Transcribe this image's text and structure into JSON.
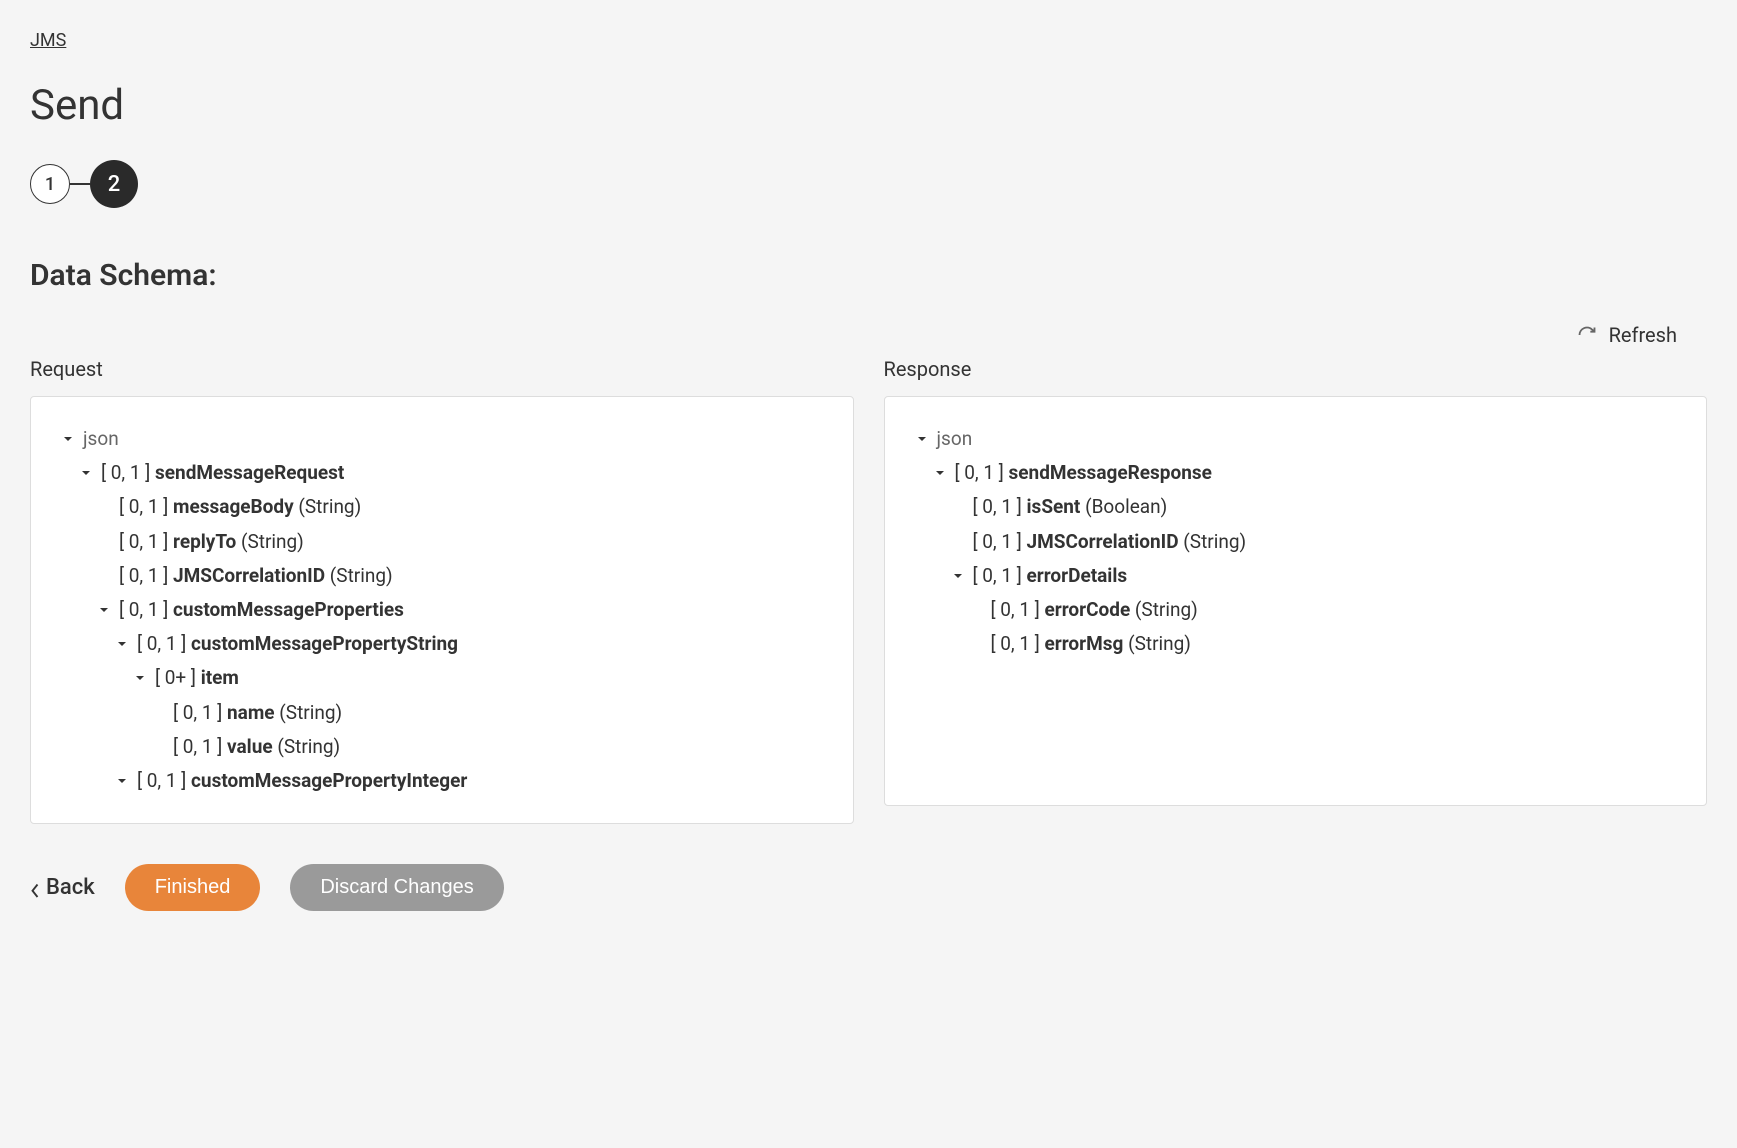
{
  "breadcrumb": "JMS",
  "page_title": "Send",
  "steps": {
    "s1": "1",
    "s2": "2"
  },
  "section_title": "Data Schema:",
  "refresh_label": "Refresh",
  "request": {
    "label": "Request",
    "tree": [
      {
        "indent": 0,
        "expandable": true,
        "root": "json"
      },
      {
        "indent": 1,
        "expandable": true,
        "cardinality": "[ 0, 1 ]",
        "name": "sendMessageRequest"
      },
      {
        "indent": 2,
        "expandable": false,
        "cardinality": "[ 0, 1 ]",
        "name": "messageBody",
        "type": "(String)"
      },
      {
        "indent": 2,
        "expandable": false,
        "cardinality": "[ 0, 1 ]",
        "name": "replyTo",
        "type": "(String)"
      },
      {
        "indent": 2,
        "expandable": false,
        "cardinality": "[ 0, 1 ]",
        "name": "JMSCorrelationID",
        "type": "(String)"
      },
      {
        "indent": 2,
        "expandable": true,
        "cardinality": "[ 0, 1 ]",
        "name": "customMessageProperties"
      },
      {
        "indent": 3,
        "expandable": true,
        "cardinality": "[ 0, 1 ]",
        "name": "customMessagePropertyString"
      },
      {
        "indent": 4,
        "expandable": true,
        "cardinality": "[ 0+ ]",
        "name": "item"
      },
      {
        "indent": 5,
        "expandable": false,
        "cardinality": "[ 0, 1 ]",
        "name": "name",
        "type": "(String)"
      },
      {
        "indent": 5,
        "expandable": false,
        "cardinality": "[ 0, 1 ]",
        "name": "value",
        "type": "(String)"
      },
      {
        "indent": 3,
        "expandable": true,
        "cardinality": "[ 0, 1 ]",
        "name": "customMessagePropertyInteger"
      }
    ]
  },
  "response": {
    "label": "Response",
    "tree": [
      {
        "indent": 0,
        "expandable": true,
        "root": "json"
      },
      {
        "indent": 1,
        "expandable": true,
        "cardinality": "[ 0, 1 ]",
        "name": "sendMessageResponse"
      },
      {
        "indent": 2,
        "expandable": false,
        "cardinality": "[ 0, 1 ]",
        "name": "isSent",
        "type": "(Boolean)"
      },
      {
        "indent": 2,
        "expandable": false,
        "cardinality": "[ 0, 1 ]",
        "name": "JMSCorrelationID",
        "type": "(String)"
      },
      {
        "indent": 2,
        "expandable": true,
        "cardinality": "[ 0, 1 ]",
        "name": "errorDetails"
      },
      {
        "indent": 3,
        "expandable": false,
        "cardinality": "[ 0, 1 ]",
        "name": "errorCode",
        "type": "(String)"
      },
      {
        "indent": 3,
        "expandable": false,
        "cardinality": "[ 0, 1 ]",
        "name": "errorMsg",
        "type": "(String)"
      }
    ]
  },
  "footer": {
    "back": "Back",
    "finished": "Finished",
    "discard": "Discard Changes"
  }
}
